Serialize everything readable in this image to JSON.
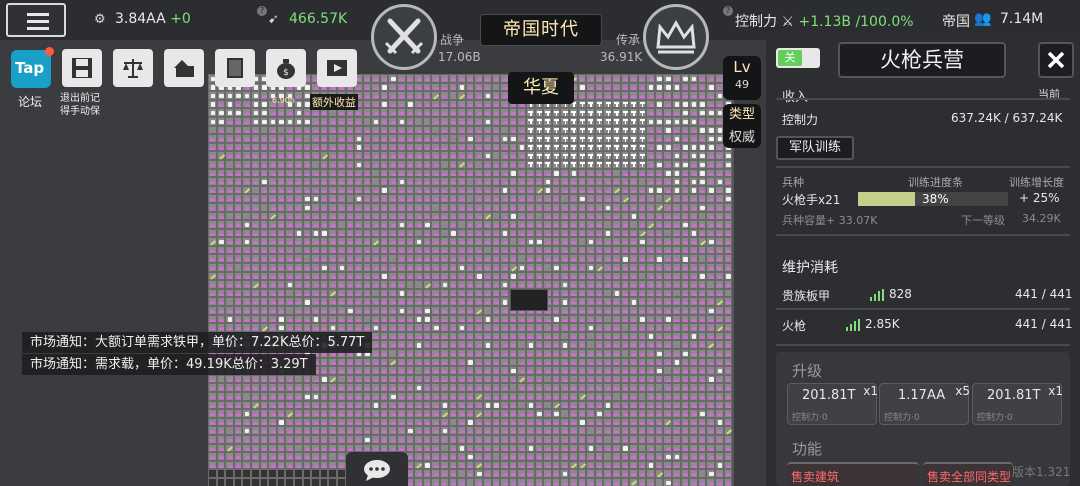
{
  "topbar": {
    "resource_1": "3.84AA",
    "resource_1_delta": "+0",
    "resource_2": "466.57K",
    "control_label": "控制力",
    "control_delta": "+1.13B",
    "control_pct": "/100.0%",
    "empire_label": "帝国",
    "population": "7.14M"
  },
  "center": {
    "era": "帝国时代",
    "war_label": "战争",
    "war_value": "17.06B",
    "legacy_label": "传承",
    "legacy_value": "36.91K",
    "nation": "华夏",
    "lv_label": "Lv",
    "lv_value": "49",
    "type_label": "类型",
    "type_value": "权威"
  },
  "tools": {
    "forum_label": "论坛",
    "forum_icon_text": "Tap",
    "save_label_1": "退出前记",
    "save_label_2": "得手动保",
    "bonus_label": "额外收益",
    "bonus_small": "6.90h"
  },
  "notices": [
    "市场通知：大额订单需求铁甲，单价：7.22K总价：5.77T",
    "市场通知：需求载，单价：49.19K总价：3.29T"
  ],
  "panel": {
    "toggle_label": "关",
    "title": "火枪兵营",
    "income_label": "收入",
    "income_right": "当前",
    "control_label": "控制力",
    "control_value": "637.24K / 637.24K",
    "train_button": "军队训练",
    "col_unit": "兵种",
    "col_progress": "训练进度条",
    "col_growth": "训练增长度",
    "unit_name": "火枪手x21",
    "progress_pct": "38%",
    "progress_value": 0.38,
    "growth": "+ 25%",
    "capacity": "兵种容量+ 33.07K",
    "next_level": "下一等级",
    "next_value": "34.29K",
    "upkeep_title": "维护消耗",
    "upkeep": [
      {
        "name": "贵族板甲",
        "amount": "828",
        "ratio": "441 / 441"
      },
      {
        "name": "火枪",
        "amount": "2.85K",
        "ratio": "441 / 441"
      }
    ],
    "upgrade_title": "升级",
    "upgrades": [
      {
        "value": "201.81T",
        "mult": "x1",
        "sub": "控制力·0"
      },
      {
        "value": "1.17AA",
        "mult": "x5",
        "sub": "控制力·0"
      },
      {
        "value": "201.81T",
        "mult": "x1",
        "sub": "控制力·0"
      }
    ],
    "function_title": "功能",
    "sell_building": "售卖建筑",
    "sell_all": "售卖全部同类型",
    "version": "版本1.321"
  },
  "colors": {
    "accent_green": "#7fe07a",
    "gold_text": "#ffe9b0",
    "pink_unit": "#d36ad8",
    "sell_red": "#ff6a6a"
  }
}
